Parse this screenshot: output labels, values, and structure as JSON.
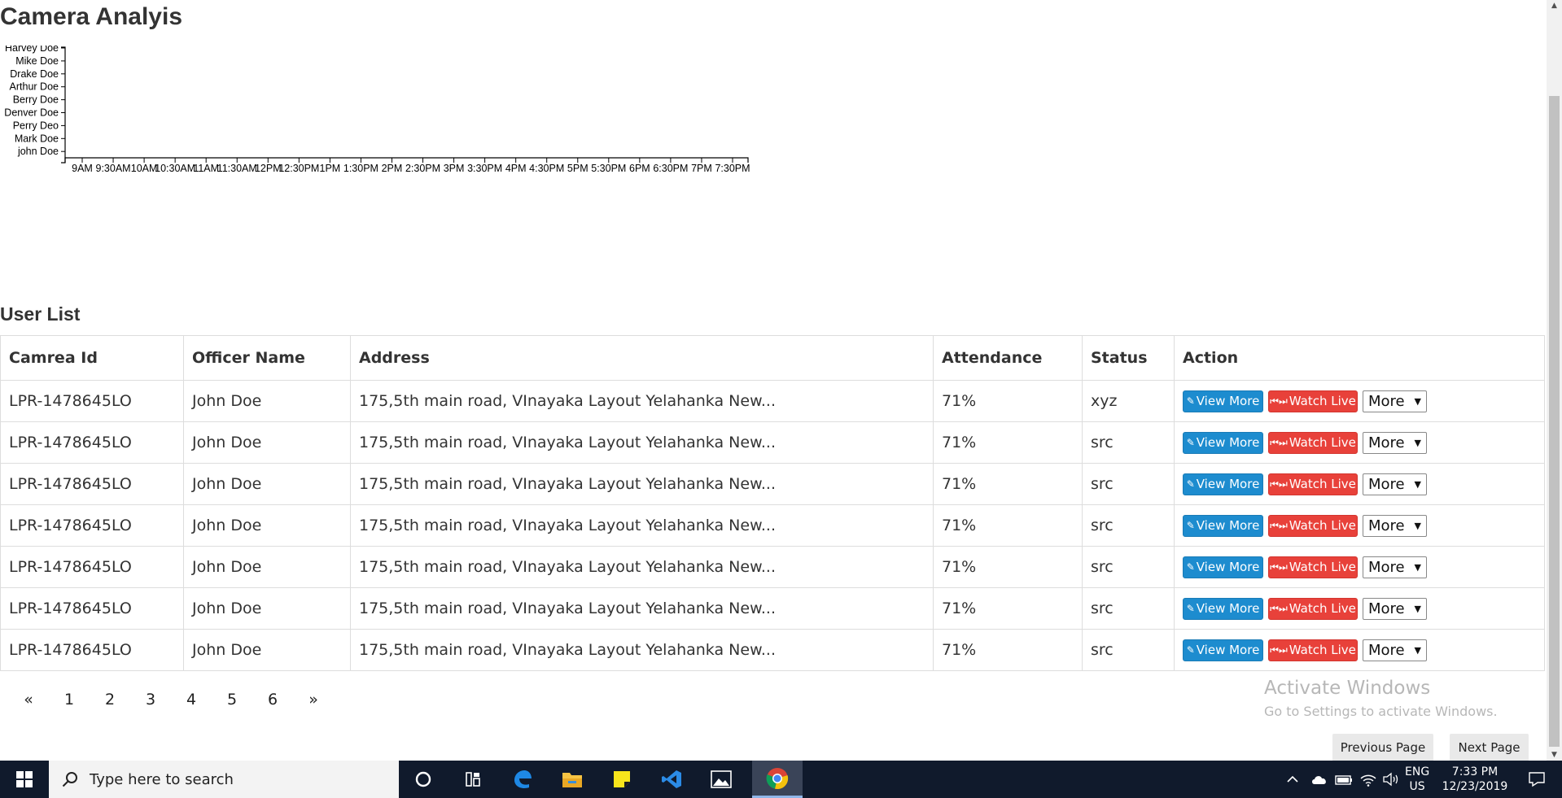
{
  "page_title": "Camera Analyis",
  "chart_data": {
    "type": "timeline",
    "categories": [
      "Harvey Doe",
      "Mike Doe",
      "Drake Doe",
      "Arthur Doe",
      "Berry Doe",
      "Denver Doe",
      "Perry Deo",
      "Mark Doe",
      "john Doe"
    ],
    "x_ticks": [
      "9AM",
      "9:30AM",
      "10AM",
      "10:30AM",
      "11AM",
      "11:30AM",
      "12PM",
      "12:30PM",
      "1PM",
      "1:30PM",
      "2PM",
      "2:30PM",
      "3PM",
      "3:30PM",
      "4PM",
      "4:30PM",
      "5PM",
      "5:30PM",
      "6PM",
      "6:30PM",
      "7PM",
      "7:30PM"
    ],
    "series": [],
    "title": "",
    "xlabel": "",
    "ylabel": "",
    "grid": false
  },
  "user_list": {
    "title": "User List",
    "columns": [
      "Camrea Id",
      "Officer Name",
      "Address",
      "Attendance",
      "Status",
      "Action"
    ],
    "rows": [
      {
        "camera_id": "LPR-1478645LO",
        "officer": "John Doe",
        "address": "175,5th main road, VInayaka Layout Yelahanka New...",
        "attendance": "71%",
        "status": "xyz"
      },
      {
        "camera_id": "LPR-1478645LO",
        "officer": "John Doe",
        "address": "175,5th main road, VInayaka Layout Yelahanka New...",
        "attendance": "71%",
        "status": "src"
      },
      {
        "camera_id": "LPR-1478645LO",
        "officer": "John Doe",
        "address": "175,5th main road, VInayaka Layout Yelahanka New...",
        "attendance": "71%",
        "status": "src"
      },
      {
        "camera_id": "LPR-1478645LO",
        "officer": "John Doe",
        "address": "175,5th main road, VInayaka Layout Yelahanka New...",
        "attendance": "71%",
        "status": "src"
      },
      {
        "camera_id": "LPR-1478645LO",
        "officer": "John Doe",
        "address": "175,5th main road, VInayaka Layout Yelahanka New...",
        "attendance": "71%",
        "status": "src"
      },
      {
        "camera_id": "LPR-1478645LO",
        "officer": "John Doe",
        "address": "175,5th main road, VInayaka Layout Yelahanka New...",
        "attendance": "71%",
        "status": "src"
      },
      {
        "camera_id": "LPR-1478645LO",
        "officer": "John Doe",
        "address": "175,5th main road, VInayaka Layout Yelahanka New...",
        "attendance": "71%",
        "status": "src"
      }
    ],
    "actions": {
      "view_more": "View More",
      "watch_live": "Watch Live",
      "more": "More",
      "view_more_icon": "edit-icon",
      "watch_live_icon": "fast-backward-forward-icon",
      "view_more_color": "#1d8ccf",
      "watch_live_color": "#e8413a"
    }
  },
  "pagination": {
    "prev": "«",
    "pages": [
      "1",
      "2",
      "3",
      "4",
      "5",
      "6"
    ],
    "next": "»"
  },
  "pager": {
    "previous_page": "Previous Page",
    "next_page": "Next Page"
  },
  "watermark": {
    "line1": "Activate Windows",
    "line2": "Go to Settings to activate Windows."
  },
  "taskbar": {
    "search_placeholder": "Type here to search",
    "apps": [
      "cortana-icon",
      "task-view-icon",
      "edge-icon",
      "file-explorer-icon",
      "sticky-notes-icon",
      "vscode-icon",
      "photos-icon",
      "chrome-icon"
    ],
    "lang_line1": "ENG",
    "lang_line2": "US",
    "time": "7:33 PM",
    "date": "12/23/2019"
  }
}
